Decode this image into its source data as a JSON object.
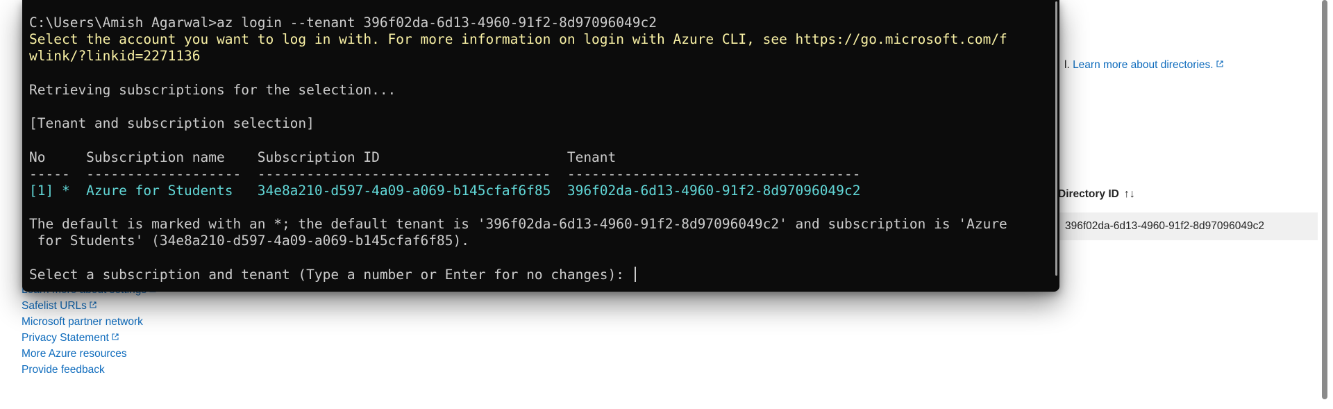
{
  "portal": {
    "directory_note_link": "Learn more about directories.",
    "directory_note_prefix": "l.",
    "table_header_directory_id": "Directory ID",
    "table_row_directory_id": "396f02da-6d13-4960-91f2-8d97096049c2",
    "left_links": [
      "Learn more about settings",
      "Safelist URLs",
      "Microsoft partner network",
      "Privacy Statement",
      "More Azure resources",
      "Provide feedback"
    ],
    "sort_icon": "sort-arrows-icon"
  },
  "terminal": {
    "lines": [
      "C:\\Users\\Amish Agarwal>az login --tenant 396f02da-6d13-4960-91f2-8d97096049c2",
      "Select the account you want to log in with. For more information on login with Azure CLI, see https://go.microsoft.com/f",
      "wlink/?linkid=2271136",
      "",
      "Retrieving subscriptions for the selection...",
      "",
      "[Tenant and subscription selection]",
      "",
      "No     Subscription name    Subscription ID                       Tenant",
      "-----  -------------------  ------------------------------------  ------------------------------------",
      "[1] *  Azure for Students   34e8a210-d597-4a09-a069-b145cfaf6f85  396f02da-6d13-4960-91f2-8d97096049c2",
      "",
      "The default is marked with an *; the default tenant is '396f02da-6d13-4960-91f2-8d97096049c2' and subscription is 'Azure",
      " for Students' (34e8a210-d597-4a09-a069-b145cfaf6f85).",
      "",
      "Select a subscription and tenant (Type a number or Enter for no changes): "
    ],
    "colors": {
      "default": "#cccccc",
      "info": "#f9f1a5",
      "highlight": "#61d6d6",
      "background": "#0c0c0c"
    }
  }
}
